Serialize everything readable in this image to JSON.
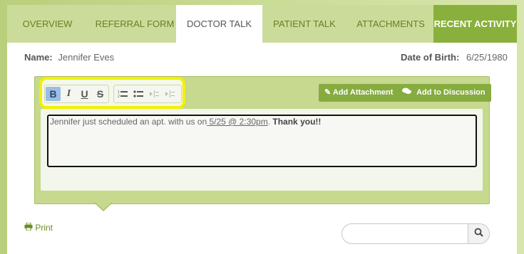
{
  "tabs": [
    {
      "label": "OVERVIEW"
    },
    {
      "label": "REFERRAL FORM"
    },
    {
      "label": "DOCTOR TALK"
    },
    {
      "label": "PATIENT TALK"
    },
    {
      "label": "ATTACHMENTS"
    },
    {
      "label": "RECENT ACTIVITY"
    }
  ],
  "active_tab": "DOCTOR TALK",
  "patient": {
    "name_label": "Name:",
    "name_value": "Jennifer Eves",
    "dob_label": "Date of Birth:",
    "dob_value": "6/25/1980"
  },
  "toolbar": {
    "format_buttons": [
      "B",
      "I",
      "U",
      "S"
    ],
    "list_buttons": [
      "ordered-list",
      "unordered-list",
      "outdent",
      "indent"
    ],
    "active_button": "bold"
  },
  "actions": {
    "add_attachment": "Add Attachment",
    "add_discussion": "Add to Discussion"
  },
  "editor": {
    "text_before": "Jennifer just scheduled an apt. with us on",
    "date_text": " 5/25 @ 2:30pm",
    "text_mid": ".  ",
    "thanks_text": "Thank you!!"
  },
  "footer": {
    "print_label": "Print",
    "search_placeholder": ""
  },
  "colors": {
    "accent": "#86ab3f",
    "tab_text": "#6b7d26",
    "highlight": "#f3f000",
    "active_button": "#9bbde6"
  }
}
